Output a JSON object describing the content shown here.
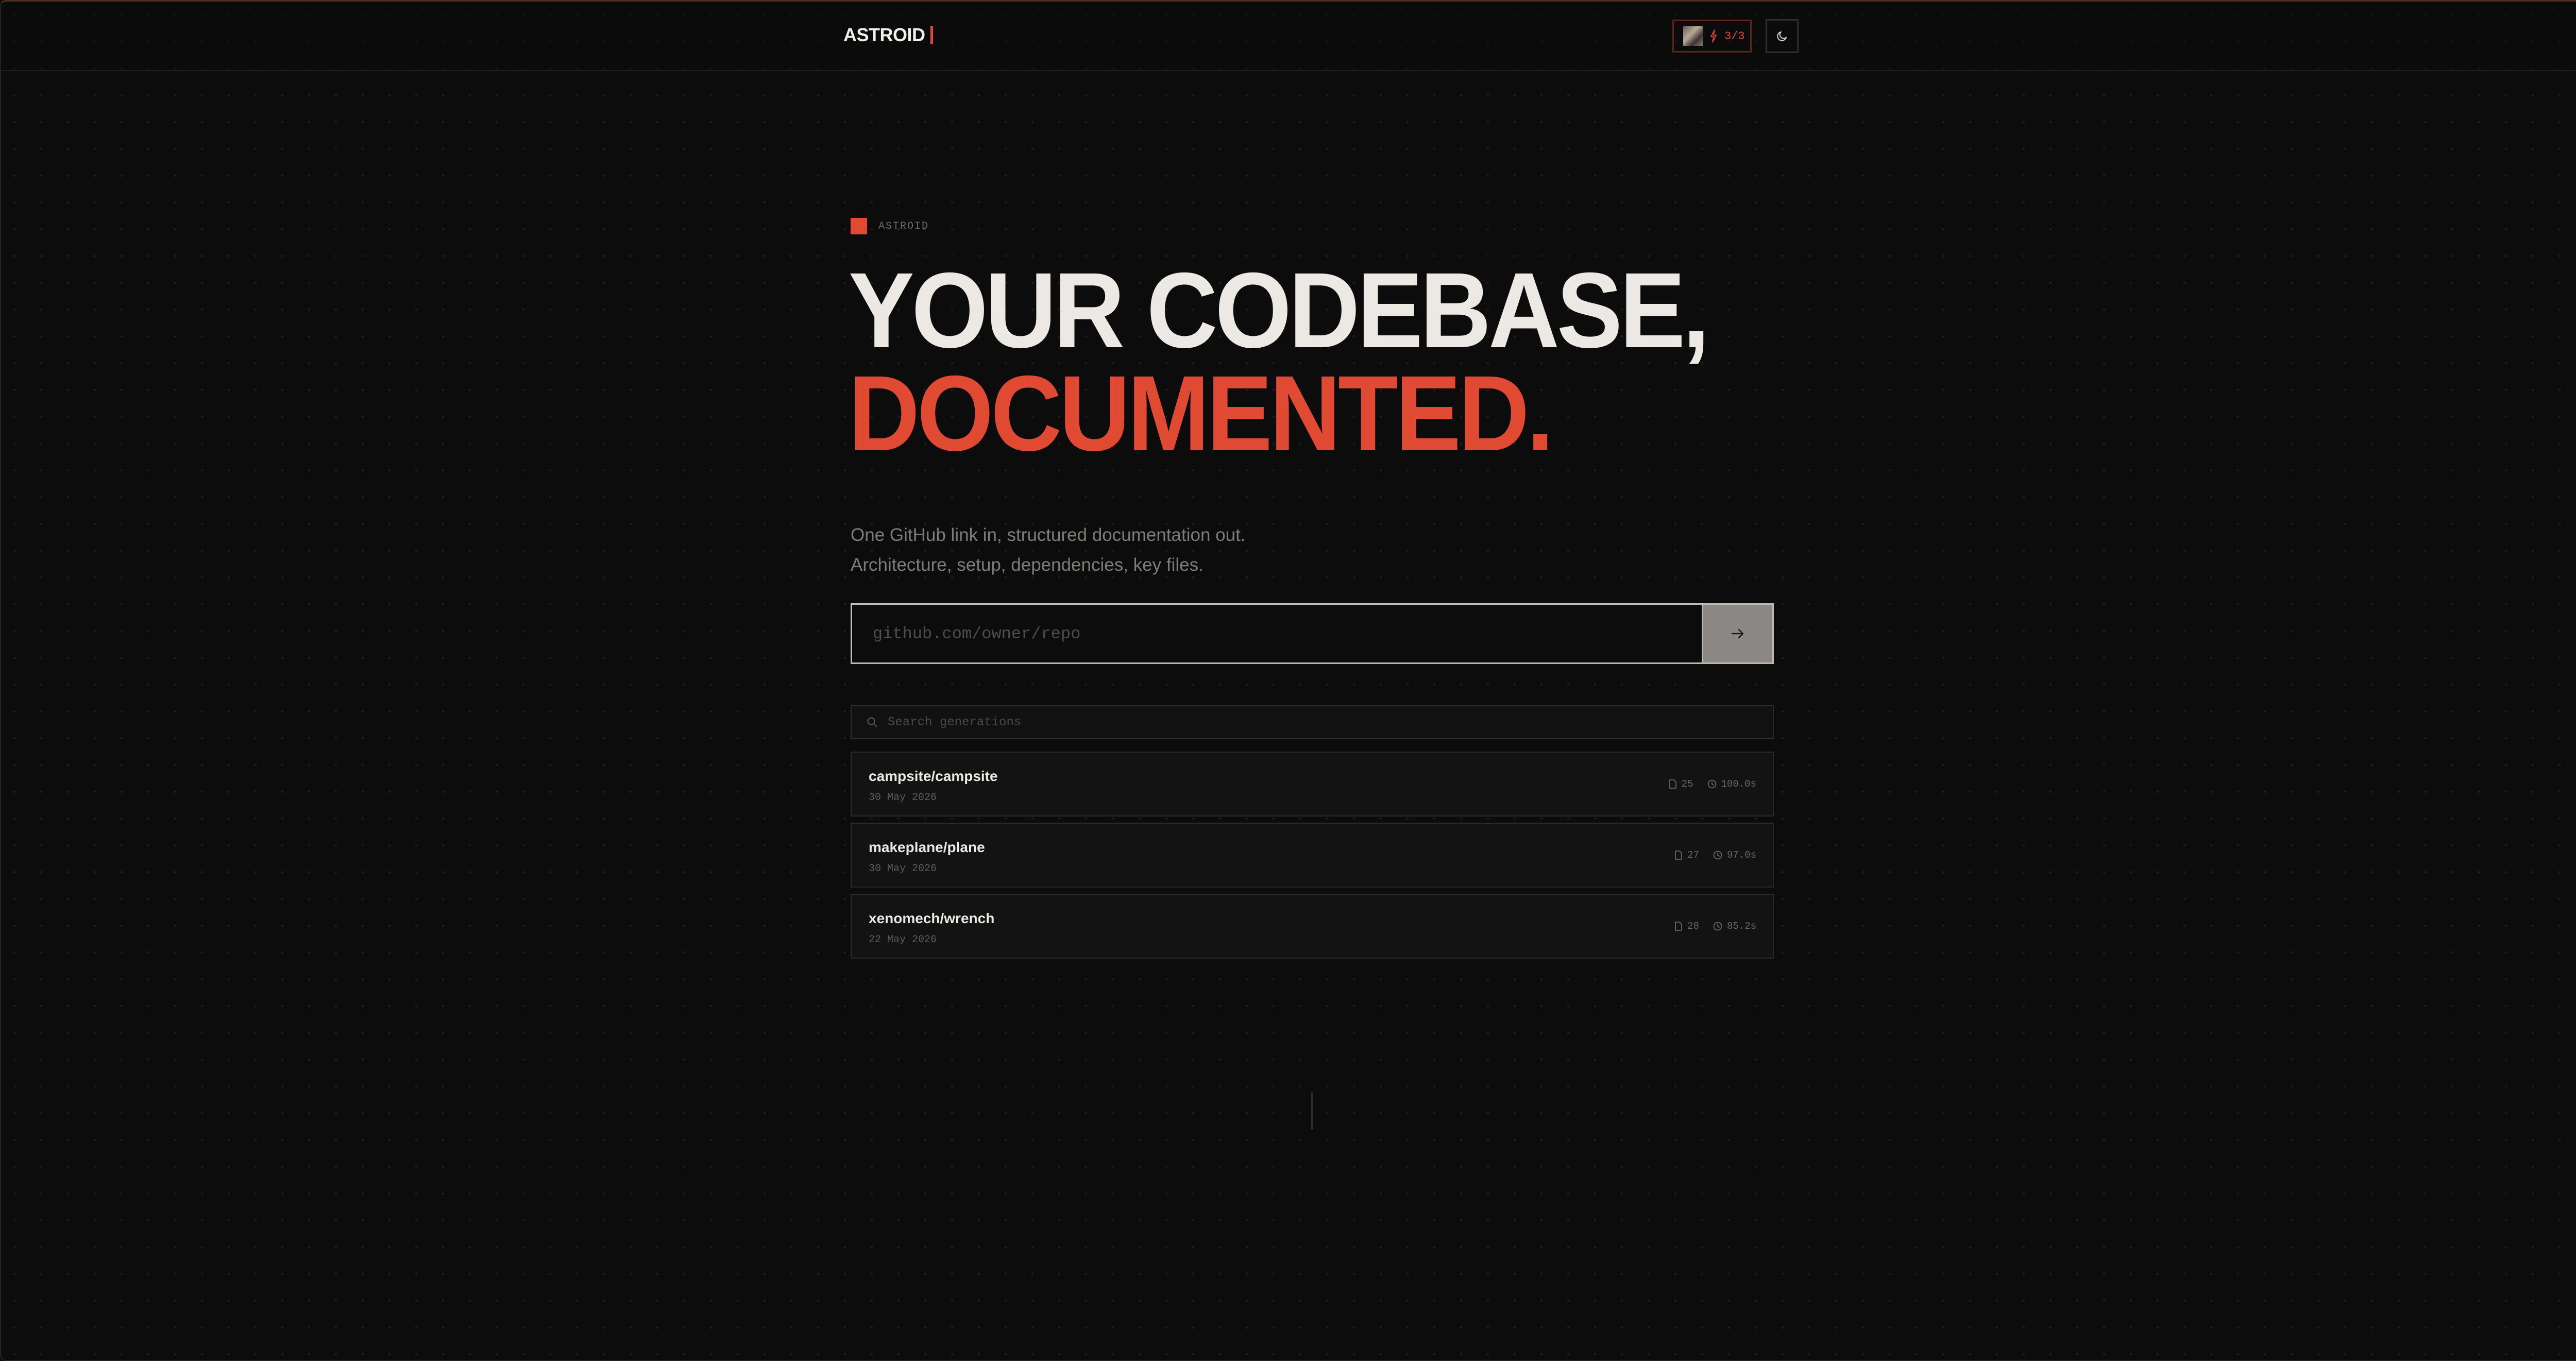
{
  "header": {
    "brand": "ASTROID",
    "credits": "3/3"
  },
  "hero": {
    "eyebrow": "ASTROID",
    "headline_line1": "YOUR CODEBASE,",
    "headline_line2": "DOCUMENTED.",
    "subtitle_line1": "One GitHub link in, structured documentation out.",
    "subtitle_line2": "Architecture, setup, dependencies, key files."
  },
  "repo_input": {
    "placeholder": "github.com/owner/repo",
    "value": ""
  },
  "search": {
    "placeholder": "Search generations"
  },
  "generations": [
    {
      "name": "campsite/campsite",
      "date": "30 May 2026",
      "files": "25",
      "duration": "100.0s"
    },
    {
      "name": "makeplane/plane",
      "date": "30 May 2026",
      "files": "27",
      "duration": "97.0s"
    },
    {
      "name": "xenomech/wrench",
      "date": "22 May 2026",
      "files": "28",
      "duration": "85.2s"
    }
  ],
  "colors": {
    "accent": "#e04a33",
    "background": "#0c0c0c",
    "text": "#ece9e4"
  },
  "icons": {
    "credits": "lightning-bolt-icon",
    "theme": "moon-icon",
    "submit": "arrow-right-icon",
    "search": "search-icon",
    "files": "file-icon",
    "duration": "clock-icon"
  }
}
